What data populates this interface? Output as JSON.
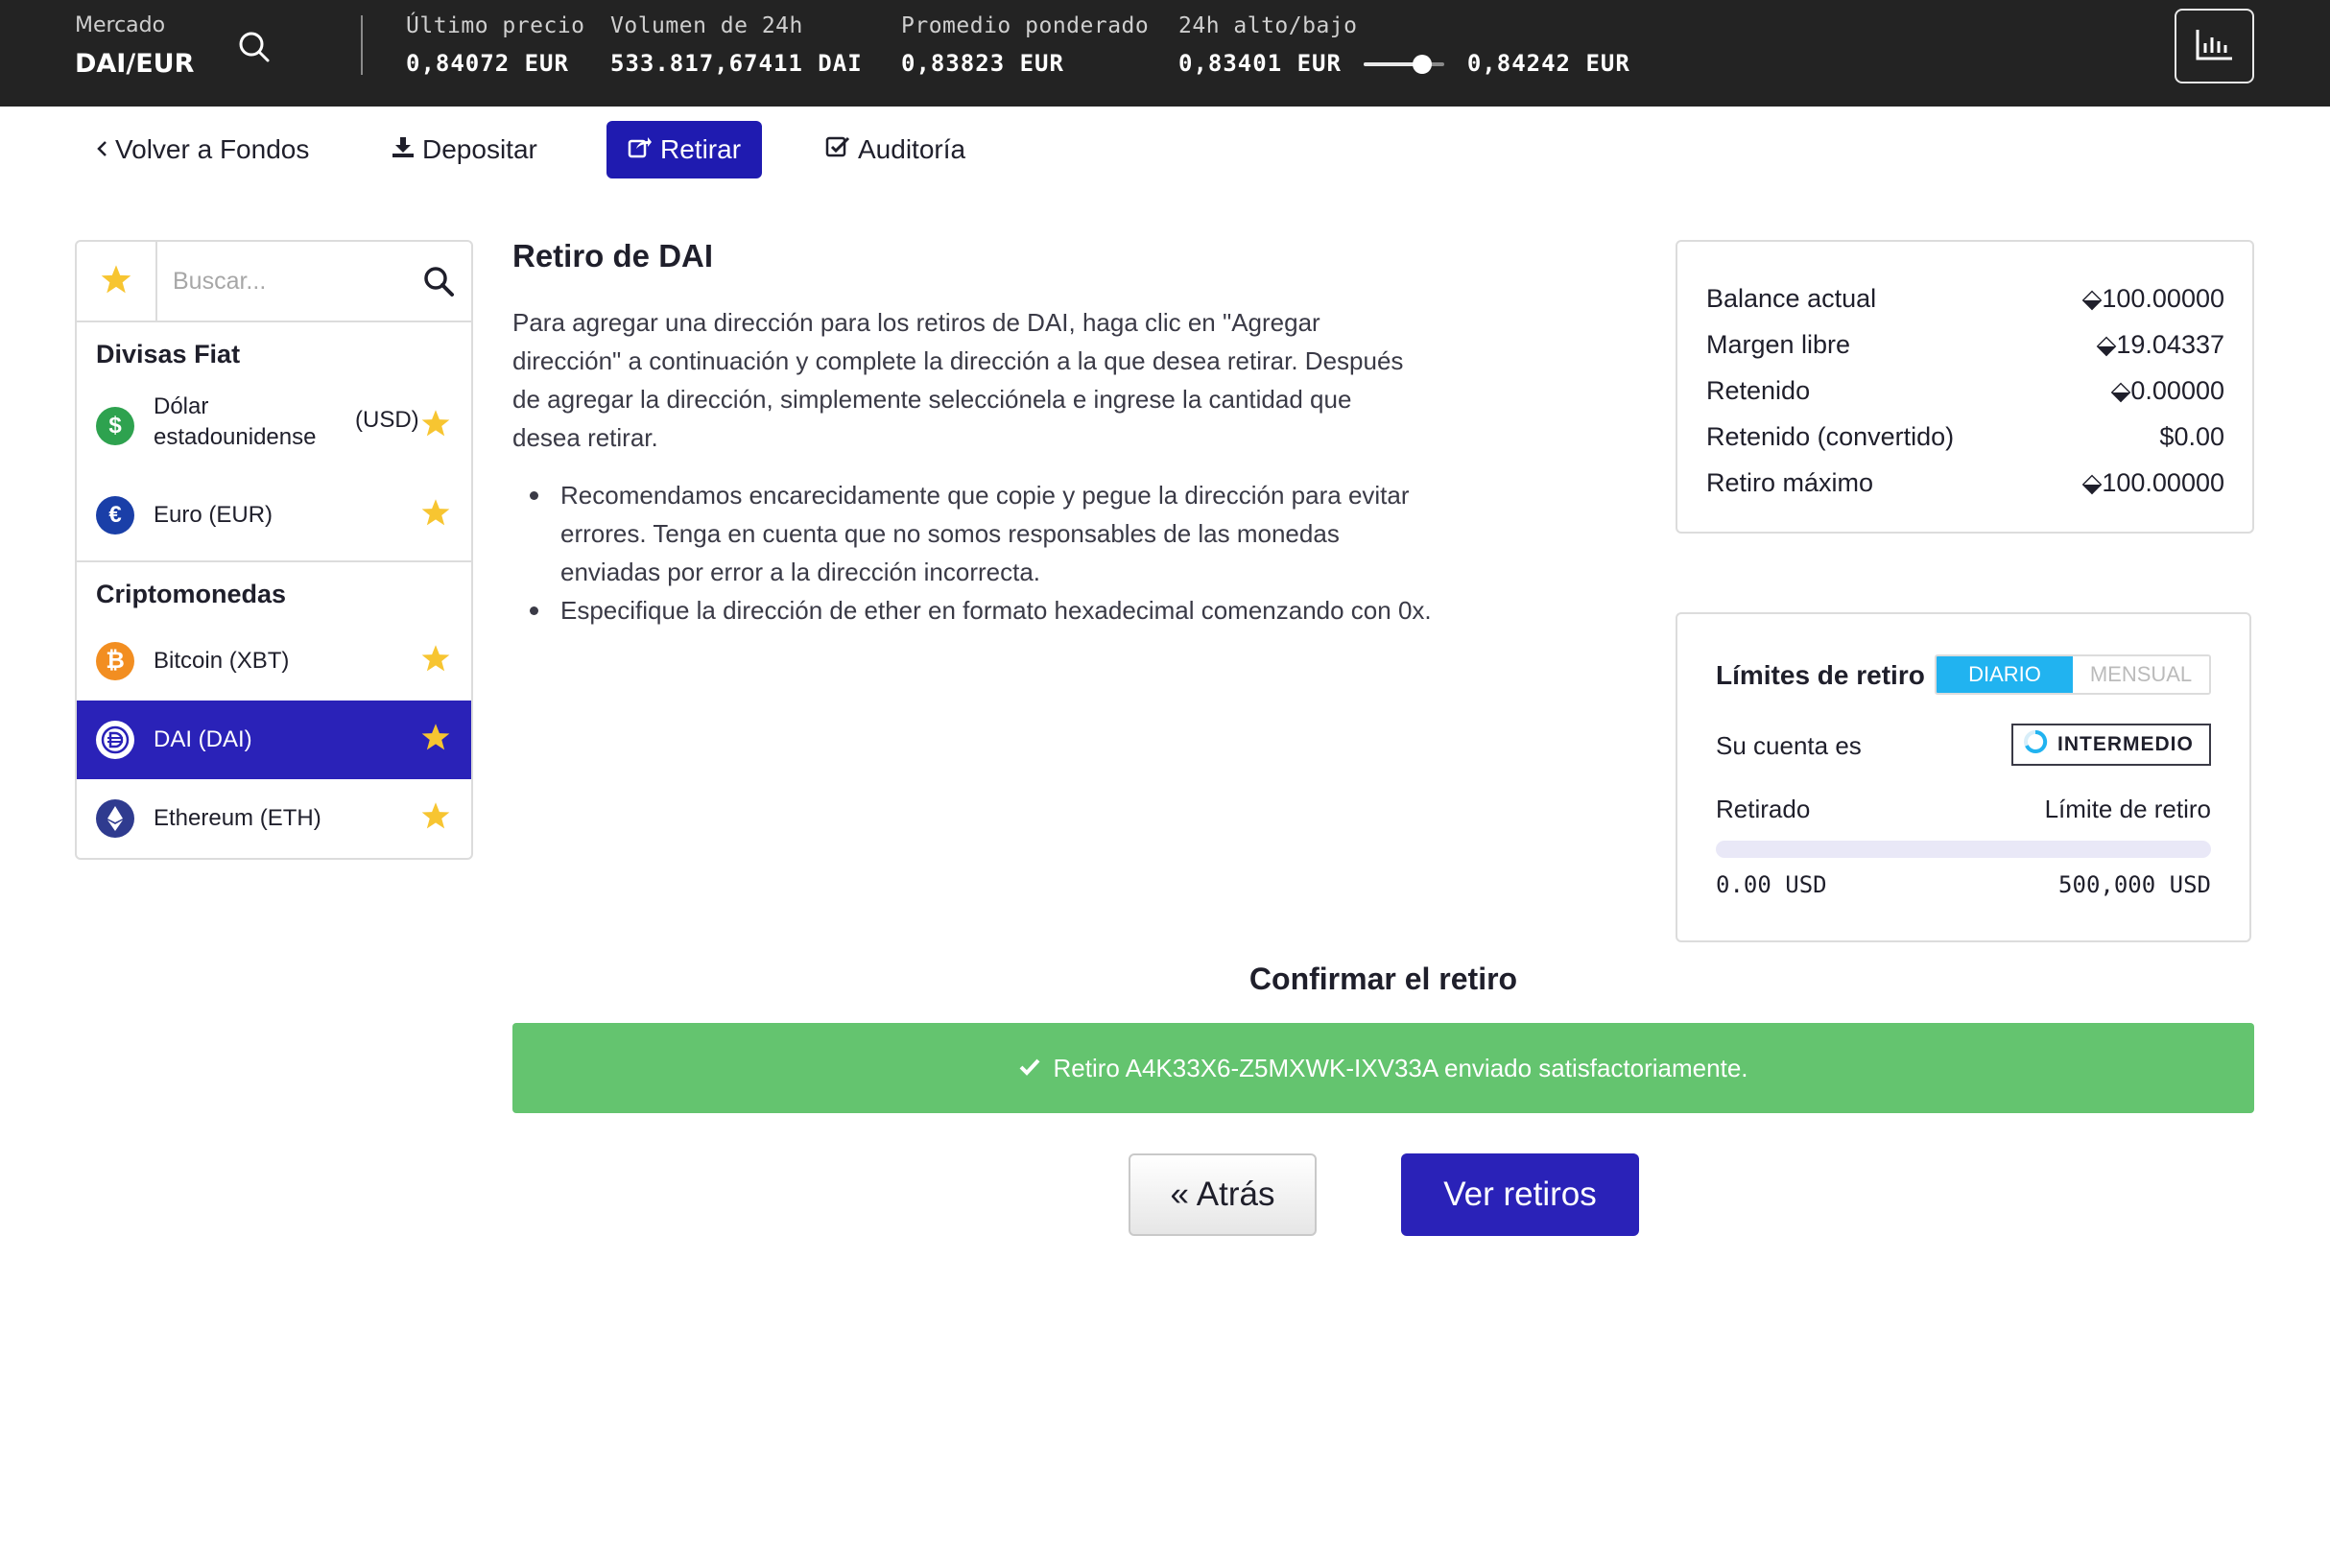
{
  "ticker": {
    "market_label": "Mercado",
    "market_value": "DAI/EUR",
    "last_price_label": "Último precio",
    "last_price_value": "0,84072 EUR",
    "volume_label": "Volumen de 24h",
    "volume_value": "533.817,67411 DAI",
    "weighted_label": "Promedio ponderado",
    "weighted_value": "0,83823 EUR",
    "highlow_label": "24h alto/bajo",
    "low_value": "0,83401 EUR",
    "high_value": "0,84242 EUR",
    "highlow_position": 0.72,
    "icons": {
      "search": "search-icon",
      "chart": "bar-chart-icon"
    }
  },
  "subnav": {
    "back_label": "Volver a Fondos",
    "deposit_label": "Depositar",
    "withdraw_label": "Retirar",
    "audit_label": "Auditoría",
    "active": "withdraw"
  },
  "sidebar": {
    "search_placeholder": "Buscar...",
    "fiat_heading": "Divisas Fiat",
    "crypto_heading": "Criptomonedas",
    "fiat_items": [
      {
        "name": "Dólar estadounidense",
        "code": "(USD)",
        "icon": "dollar-icon",
        "color": "#2ea24f"
      },
      {
        "name": "Euro (EUR)",
        "icon": "euro-icon",
        "color": "#1a3fa8"
      }
    ],
    "crypto_items": [
      {
        "name": "Bitcoin (XBT)",
        "icon": "bitcoin-icon",
        "color": "#f28e21",
        "selected": false
      },
      {
        "name": "DAI (DAI)",
        "icon": "dai-icon",
        "color": "#2a22b8",
        "selected": true
      },
      {
        "name": "Ethereum (ETH)",
        "icon": "ethereum-icon",
        "color": "#2f3b8f",
        "selected": false
      }
    ],
    "star_color": "#f7c531"
  },
  "main": {
    "title": "Retiro de DAI",
    "paragraph": "Para agregar una dirección para los retiros de DAI, haga clic en \"Agregar dirección\" a continuación y complete la dirección a la que desea retirar. Después de agregar la dirección, simplemente selecciónela e ingrese la cantidad que desea retirar.",
    "bullets": [
      "Recomendamos encarecidamente que copie y pegue la dirección para evitar errores. Tenga en cuenta que no somos responsables de las monedas enviadas por error a la dirección incorrecta.",
      "Especifique la dirección de ether en formato hexadecimal comenzando con 0x."
    ]
  },
  "balance": {
    "rows": [
      {
        "label": "Balance actual",
        "value": "⬙100.00000"
      },
      {
        "label": "Margen libre",
        "value": "⬙19.04337"
      },
      {
        "label": "Retenido",
        "value": "⬙0.00000"
      },
      {
        "label": "Retenido (convertido)",
        "value": "$0.00"
      },
      {
        "label": "Retiro máximo",
        "value": "⬙100.00000"
      }
    ]
  },
  "limits": {
    "title": "Límites de retiro",
    "daily_label": "DIARIO",
    "monthly_label": "MENSUAL",
    "account_label": "Su cuenta es",
    "account_level": "INTERMEDIO",
    "withdrawn_label": "Retirado",
    "limit_label": "Límite de retiro",
    "withdrawn_value": "0.00 USD",
    "limit_value": "500,000 USD",
    "progress_fraction": 0
  },
  "confirm": {
    "title": "Confirmar el retiro",
    "success_message": "Retiro A4K33X6-Z5MXWK-IXV33A enviado satisfactoriamente.",
    "back_button": "« Atrás",
    "view_button": "Ver retiros"
  },
  "colors": {
    "accent": "#2a22b8",
    "success": "#64c46f",
    "toggle_on": "#21b3f0",
    "topbar": "#232323"
  }
}
